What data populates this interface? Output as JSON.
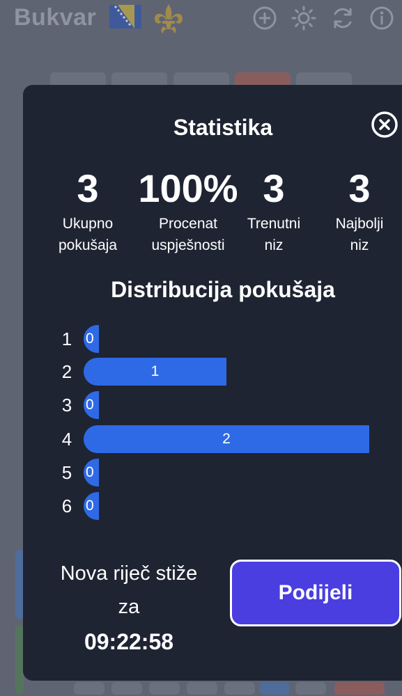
{
  "app": {
    "title": "Bukvar",
    "header_icons": [
      "plus-circle-icon",
      "sun-icon",
      "refresh-icon",
      "info-icon"
    ]
  },
  "stats_modal": {
    "title": "Statistika",
    "close_icon": "close-icon",
    "stats": [
      {
        "value": "3",
        "label_line1": "Ukupno",
        "label_line2": "pokušaja"
      },
      {
        "value": "100%",
        "label_line1": "Procenat",
        "label_line2": "uspješnosti"
      },
      {
        "value": "3",
        "label_line1": "Trenutni",
        "label_line2": "niz"
      },
      {
        "value": "3",
        "label_line1": "Najbolji",
        "label_line2": "niz"
      }
    ],
    "distribution_title": "Distribucija pokušaja",
    "distribution": [
      {
        "guess": "1",
        "count": 0
      },
      {
        "guess": "2",
        "count": 1
      },
      {
        "guess": "3",
        "count": 0
      },
      {
        "guess": "4",
        "count": 2
      },
      {
        "guess": "5",
        "count": 0
      },
      {
        "guess": "6",
        "count": 0
      }
    ],
    "next_word_line1": "Nova riječ stiže",
    "next_word_line2": "za",
    "next_word_time": "09:22:58",
    "share_label": "Podijeli"
  },
  "colors": {
    "accent_blue": "#2f6ae6",
    "share_purple": "#4a3ee0",
    "modal_bg": "#1e2432",
    "backdrop": "#5f6473"
  }
}
